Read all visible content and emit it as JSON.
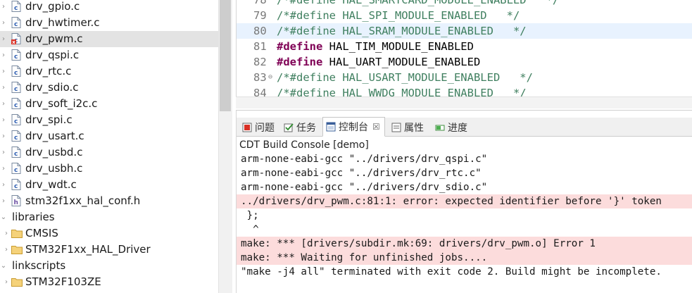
{
  "explorer": {
    "items": [
      {
        "label": "drv_gpio.c",
        "type": "c-file",
        "state": "normal"
      },
      {
        "label": "drv_hwtimer.c",
        "type": "c-file",
        "state": "normal"
      },
      {
        "label": "drv_pwm.c",
        "type": "c-file",
        "state": "error-selected"
      },
      {
        "label": "drv_qspi.c",
        "type": "c-file",
        "state": "normal"
      },
      {
        "label": "drv_rtc.c",
        "type": "c-file",
        "state": "normal"
      },
      {
        "label": "drv_sdio.c",
        "type": "c-file",
        "state": "normal"
      },
      {
        "label": "drv_soft_i2c.c",
        "type": "c-file",
        "state": "normal"
      },
      {
        "label": "drv_spi.c",
        "type": "c-file",
        "state": "normal"
      },
      {
        "label": "drv_usart.c",
        "type": "c-file",
        "state": "normal"
      },
      {
        "label": "drv_usbd.c",
        "type": "c-file",
        "state": "normal"
      },
      {
        "label": "drv_usbh.c",
        "type": "c-file",
        "state": "normal"
      },
      {
        "label": "drv_wdt.c",
        "type": "c-file",
        "state": "normal"
      },
      {
        "label": "stm32f1xx_hal_conf.h",
        "type": "h-file",
        "state": "normal"
      },
      {
        "label": "libraries",
        "type": "folder-open",
        "state": "normal"
      },
      {
        "label": "CMSIS",
        "type": "folder",
        "state": "normal"
      },
      {
        "label": "STM32F1xx_HAL_Driver",
        "type": "folder",
        "state": "normal"
      },
      {
        "label": "linkscripts",
        "type": "folder-open",
        "state": "normal"
      },
      {
        "label": "STM32F103ZE",
        "type": "folder",
        "state": "normal"
      }
    ]
  },
  "editor": {
    "lines": [
      {
        "num": "78",
        "fold": "",
        "kw": "",
        "text": "/*#define HAL_SMARTCARD_MODULE_ENABLED   */",
        "current": false
      },
      {
        "num": "79",
        "fold": "",
        "kw": "",
        "text": "/*#define HAL_SPI_MODULE_ENABLED   */",
        "current": false
      },
      {
        "num": "80",
        "fold": "",
        "kw": "",
        "text": "/*#define HAL_SRAM_MODULE_ENABLED   */",
        "current": true
      },
      {
        "num": "81",
        "fold": "",
        "kw": "#define",
        "text": " HAL_TIM_MODULE_ENABLED",
        "current": false
      },
      {
        "num": "82",
        "fold": "",
        "kw": "#define",
        "text": " HAL_UART_MODULE_ENABLED",
        "current": false
      },
      {
        "num": "83",
        "fold": "⊖",
        "kw": "",
        "text": "/*#define HAL_USART_MODULE_ENABLED   */",
        "current": false
      },
      {
        "num": "84",
        "fold": "",
        "kw": "",
        "text": "/*#define HAL_WWDG_MODULE_ENABLED   */",
        "current": false
      }
    ]
  },
  "panel": {
    "tabs": [
      {
        "label": "问题",
        "icon": "problems-icon",
        "active": false
      },
      {
        "label": "任务",
        "icon": "tasks-icon",
        "active": false
      },
      {
        "label": "控制台",
        "icon": "console-icon",
        "active": true,
        "close": "☒"
      },
      {
        "label": "属性",
        "icon": "properties-icon",
        "active": false
      },
      {
        "label": "进度",
        "icon": "progress-icon",
        "active": false
      }
    ],
    "console_title": "CDT Build Console [demo]",
    "console_lines": [
      {
        "text": "arm-none-eabi-gcc \"../drivers/drv_qspi.c\"",
        "error": false
      },
      {
        "text": "arm-none-eabi-gcc \"../drivers/drv_rtc.c\"",
        "error": false
      },
      {
        "text": "arm-none-eabi-gcc \"../drivers/drv_sdio.c\"",
        "error": false
      },
      {
        "text": "../drivers/drv_pwm.c:81:1: error: expected identifier before '}' token",
        "error": true
      },
      {
        "text": " };",
        "error": false
      },
      {
        "text": "  ^",
        "error": false
      },
      {
        "text": "make: *** [drivers/subdir.mk:69: drivers/drv_pwm.o] Error 1",
        "error": true
      },
      {
        "text": "make: *** Waiting for unfinished jobs....",
        "error": true
      },
      {
        "text": "\"make -j4 all\" terminated with exit code 2. Build might be incomplete.",
        "error": false
      }
    ]
  },
  "colors": {
    "comment": "#3f7f5f",
    "keyword": "#7f0055",
    "error_bg": "#fcdcdc",
    "current_line": "#e8f2fe"
  }
}
